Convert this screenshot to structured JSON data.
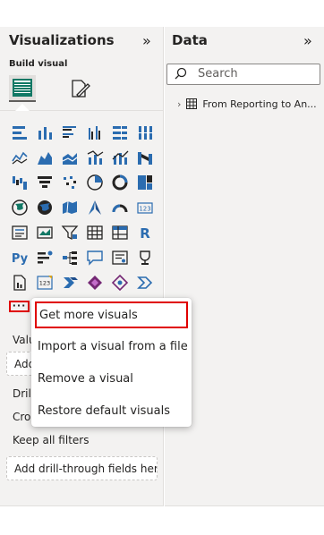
{
  "visualizations_pane": {
    "title": "Visualizations",
    "collapse_icon": "chevron-double-right-icon",
    "build_visual_label": "Build visual",
    "more_button_label": "···",
    "visual_icons": [
      "stacked-bar-icon",
      "stacked-column-icon",
      "clustered-bar-icon",
      "clustered-column-icon",
      "100-stacked-bar-icon",
      "100-stacked-column-icon",
      "line-chart-icon",
      "area-chart-icon",
      "stacked-area-icon",
      "line-clustered-column-icon",
      "line-stacked-column-icon",
      "ribbon-chart-icon",
      "waterfall-icon",
      "funnel-icon",
      "scatter-icon",
      "pie-chart-icon",
      "donut-chart-icon",
      "treemap-icon",
      "map-icon",
      "filled-map-icon",
      "shape-map-icon",
      "azure-map-icon",
      "gauge-icon",
      "card-icon",
      "multi-row-card-icon",
      "kpi-icon",
      "slicer-icon",
      "table-icon",
      "matrix-icon",
      "r-visual-icon",
      "python-visual-icon",
      "key-influencers-icon",
      "decomposition-tree-icon",
      "qa-icon",
      "smart-narrative-icon",
      "goals-icon",
      "paginated-report-icon",
      "new-card-icon",
      "power-automate-icon",
      "power-apps-icon",
      "new-slicer-icon",
      "more-visual-icon"
    ],
    "sections": {
      "values_label": "Valu",
      "values_placeholder": "Add",
      "drill_label": "Drill",
      "cross_report_label": "Cros",
      "keep_all_filters_label": "Keep all filters",
      "keep_all_filters_toggle": "On",
      "drill_through_placeholder": "Add drill-through fields here"
    }
  },
  "data_pane": {
    "title": "Data",
    "collapse_icon": "chevron-double-right-icon",
    "search": {
      "placeholder": "Search"
    },
    "tree": [
      {
        "label": "From Reporting to An...",
        "icon": "table-icon",
        "expanded": false
      }
    ]
  },
  "context_menu": {
    "items": [
      {
        "label": "Get more visuals",
        "highlighted": true
      },
      {
        "label": "Import a visual from a file",
        "highlighted": false
      },
      {
        "label": "Remove a visual",
        "highlighted": false
      },
      {
        "label": "Restore default visuals",
        "highlighted": false
      }
    ]
  },
  "colors": {
    "pane_background": "#f3f2f1",
    "accent_blue": "#2b6cb0",
    "toggle_on": "#117865",
    "highlight_red": "#e00000"
  }
}
